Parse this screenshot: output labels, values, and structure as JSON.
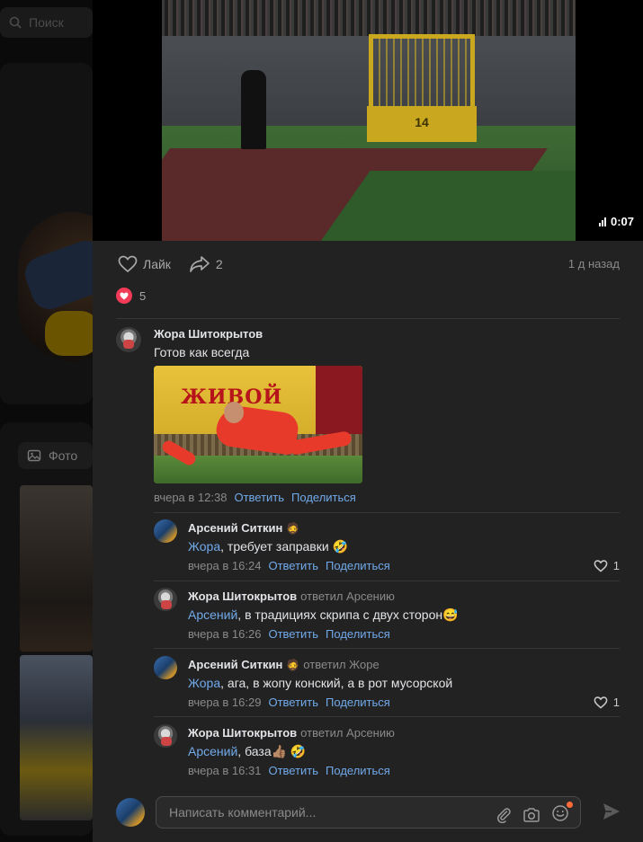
{
  "background": {
    "search_placeholder": "Поиск",
    "photo_tab_label": "Фото"
  },
  "video": {
    "duration": "0:07",
    "stand_number": "14"
  },
  "post_actions": {
    "like_label": "Лайк",
    "share_count": "2",
    "date": "1 д назад",
    "reaction_count": "5"
  },
  "comments": [
    {
      "author": "Жора Шитокрытов",
      "text": "Готов как всегда",
      "image_banner_text": "ЖИВОЙ",
      "time": "вчера в 12:38",
      "reply_label": "Ответить",
      "share_label": "Поделиться"
    },
    {
      "author": "Арсений Ситкин",
      "author_emoji": "🧔",
      "mention": "Жора",
      "text": ", требует заправки 🤣",
      "time": "вчера в 16:24",
      "reply_label": "Ответить",
      "share_label": "Поделиться",
      "likes": "1"
    },
    {
      "author": "Жора Шитокрытов",
      "reply_to": "ответил Арсению",
      "mention": "Арсений",
      "text": ", в традициях скрипа с двух сторон😅",
      "time": "вчера в 16:26",
      "reply_label": "Ответить",
      "share_label": "Поделиться"
    },
    {
      "author": "Арсений Ситкин",
      "author_emoji": "🧔",
      "reply_to": "ответил Жоре",
      "mention": "Жора",
      "text": ", ага, в жопу конский, а в рот мусорской",
      "time": "вчера в 16:29",
      "reply_label": "Ответить",
      "share_label": "Поделиться",
      "likes": "1"
    },
    {
      "author": "Жора Шитокрытов",
      "reply_to": "ответил Арсению",
      "mention": "Арсений",
      "text": ", база👍🏽 🤣",
      "time": "вчера в 16:31",
      "reply_label": "Ответить",
      "share_label": "Поделиться"
    }
  ],
  "composer": {
    "placeholder": "Написать комментарий..."
  },
  "colors": {
    "accent_link": "#71aaeb",
    "reaction_heart": "#f23c57",
    "notification_dot": "#ff6a3a",
    "panel_bg": "#222222"
  }
}
